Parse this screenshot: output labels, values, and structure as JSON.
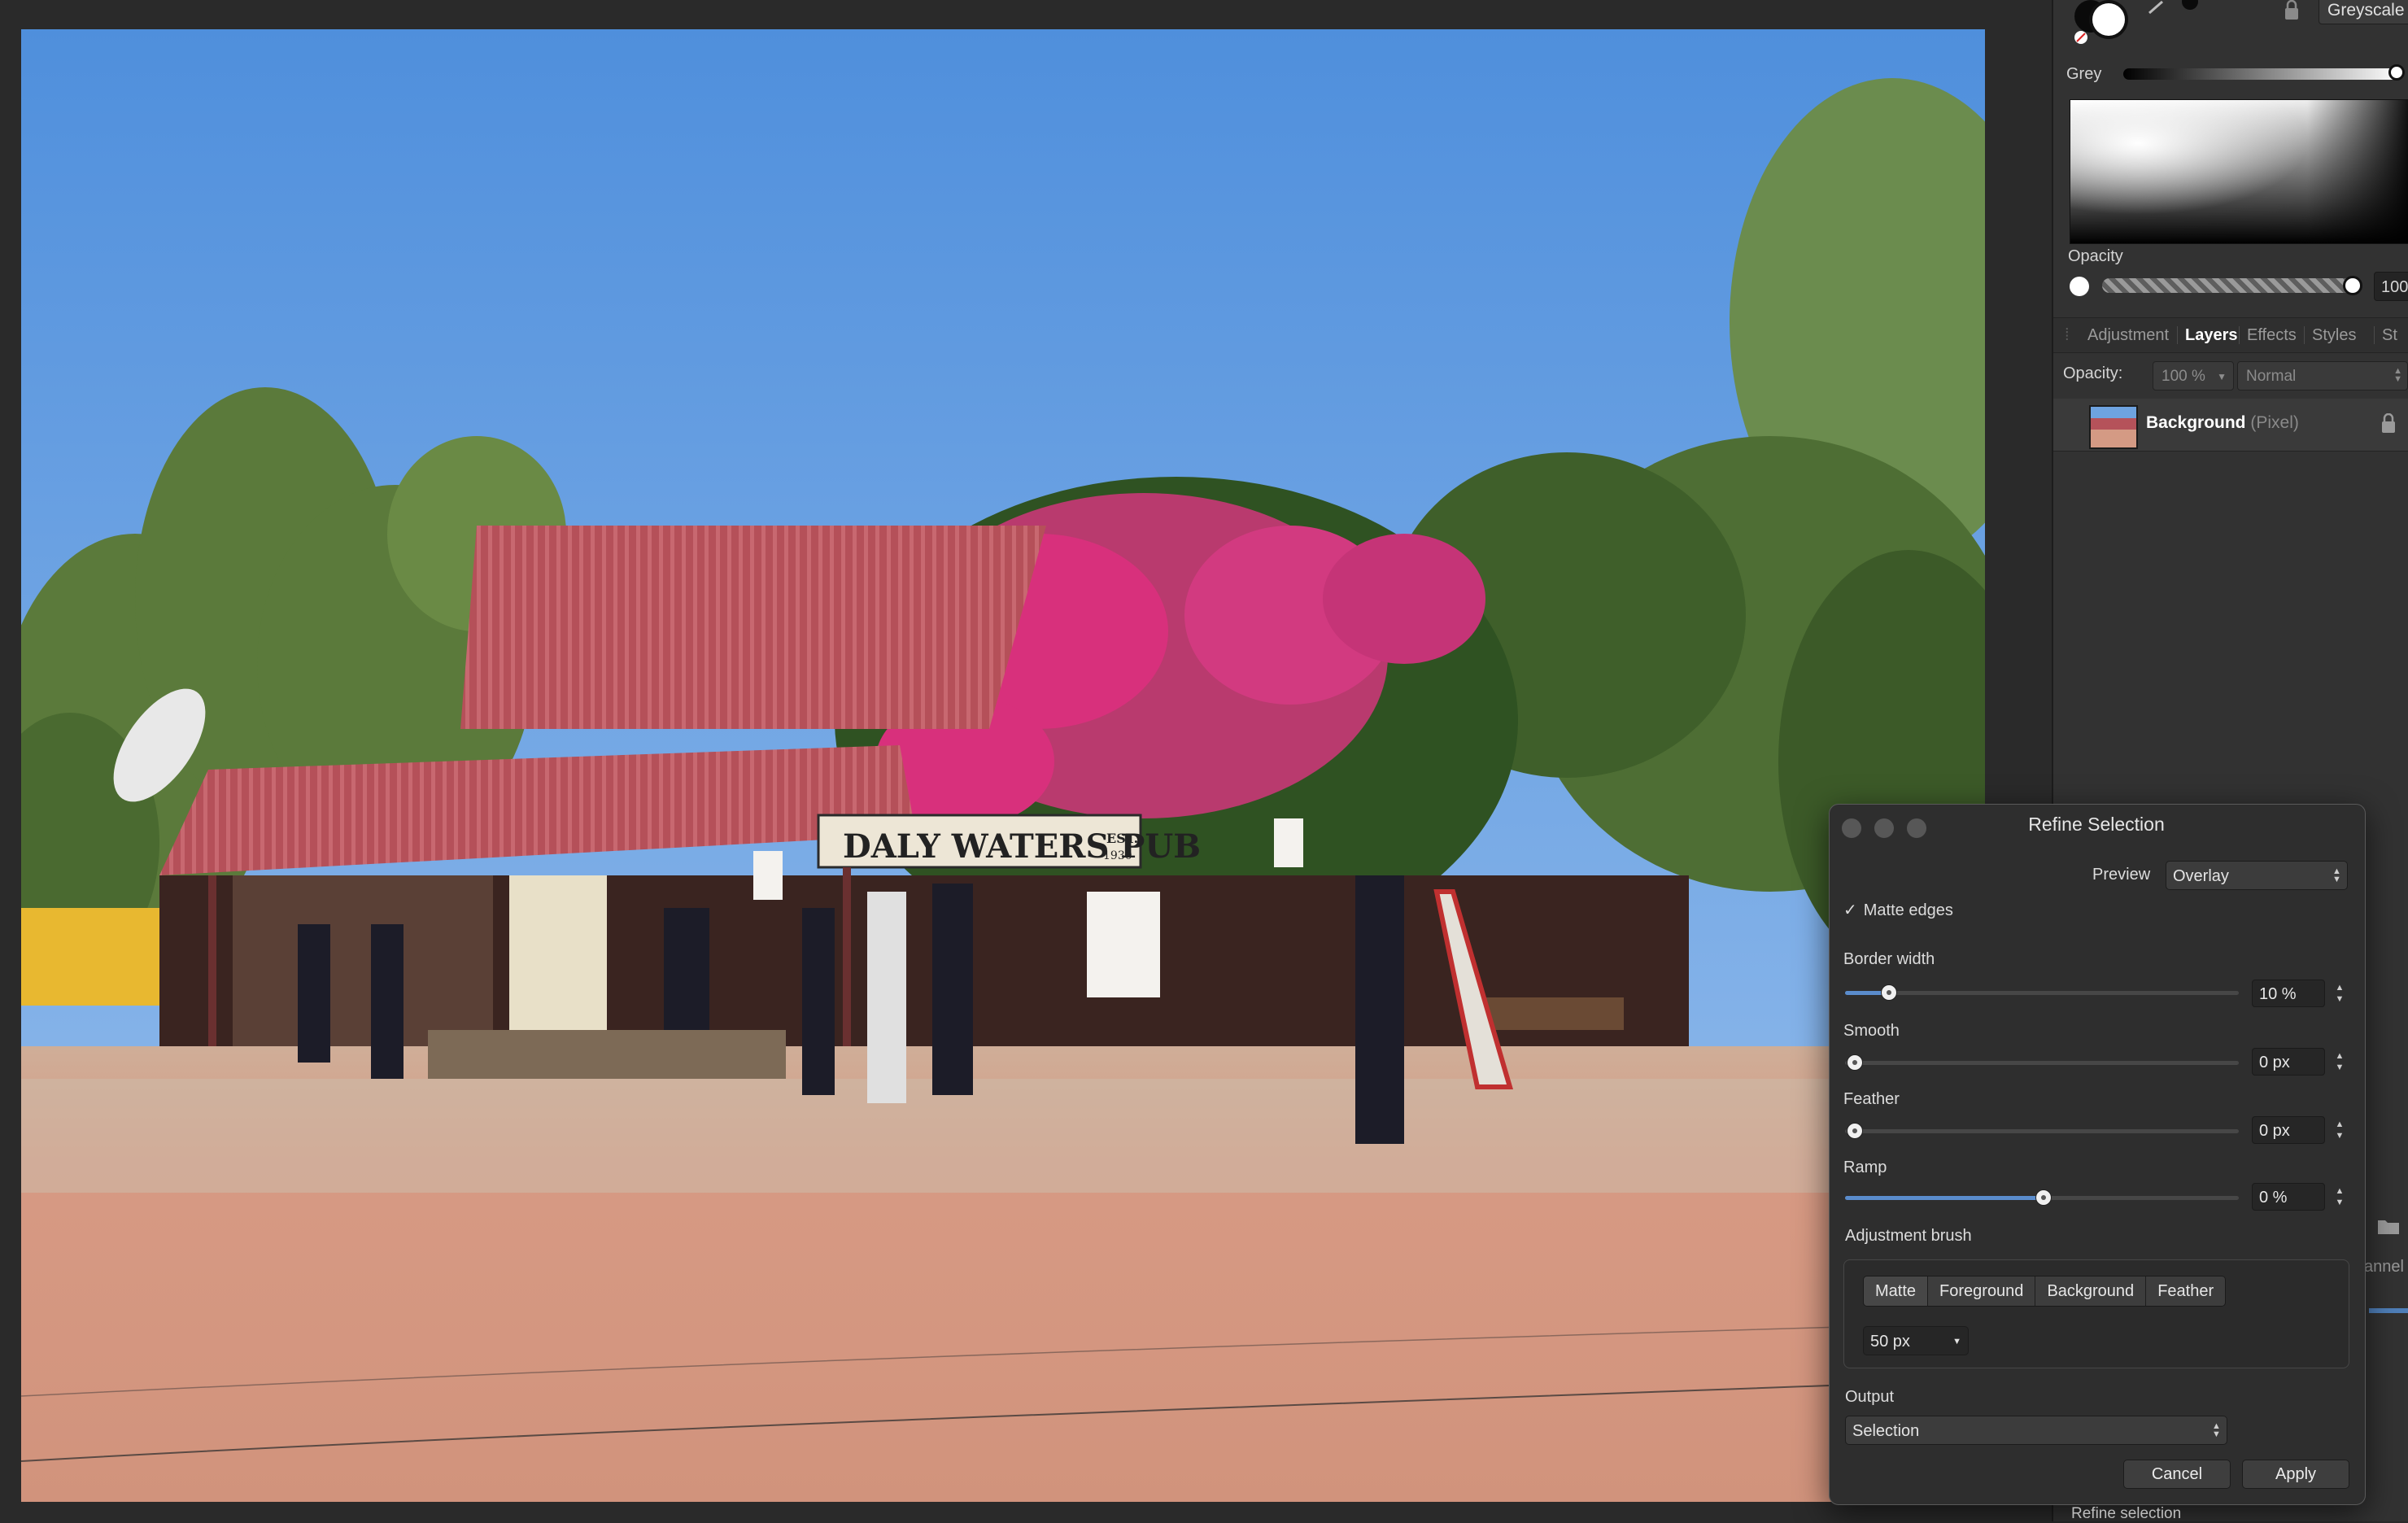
{
  "color_panel": {
    "mode_label": "Greyscale",
    "grey_label": "Grey",
    "grey_level": 1.0,
    "opacity_label": "Opacity",
    "opacity_value": "100",
    "opacity_level": 0.97
  },
  "layers_panel": {
    "tabs": [
      "Adjustment",
      "Layers",
      "Effects",
      "Styles",
      "St"
    ],
    "active_tab": "Layers",
    "opacity_label": "Opacity:",
    "opacity_value": "100 %",
    "blend_mode": "Normal",
    "layer": {
      "name": "Background",
      "type": "(Pixel)",
      "locked": true
    }
  },
  "refine_dialog": {
    "title": "Refine Selection",
    "preview_label": "Preview",
    "preview_value": "Overlay",
    "matte_edges_label": "Matte edges",
    "matte_edges_checked": true,
    "check_glyph": "✓",
    "border_width": {
      "label": "Border width",
      "value": "10 %",
      "level": 0.11
    },
    "smooth": {
      "label": "Smooth",
      "value": "0 px",
      "level": 0.0
    },
    "feather": {
      "label": "Feather",
      "value": "0 px",
      "level": 0.0
    },
    "ramp": {
      "label": "Ramp",
      "value": "0 %",
      "level": 0.5
    },
    "adjustment_brush_label": "Adjustment brush",
    "brush_modes": [
      "Matte",
      "Foreground",
      "Background",
      "Feather"
    ],
    "brush_size": "50 px",
    "output_label": "Output",
    "output_value": "Selection",
    "cancel_label": "Cancel",
    "apply_label": "Apply"
  },
  "photo_sign_text": "DALY WATERS PUB",
  "photo_sign_est": "EST.",
  "photo_sign_year": "1930",
  "status_bar": {
    "hint": "Refine selection"
  },
  "side_fragment": {
    "label": "annel"
  },
  "colors": {
    "accent": "#5a8ccc",
    "panel_bg": "#323232",
    "dialog_bg": "#2e2e2e",
    "sky": "#6ea3e0",
    "dirt": "#d49a84",
    "roof": "#b5525a",
    "bougainvillea": "#d8307c"
  },
  "icons": [
    "lock-icon",
    "folder-icon",
    "check-icon",
    "updown-icon",
    "dropdown-caret-icon"
  ]
}
